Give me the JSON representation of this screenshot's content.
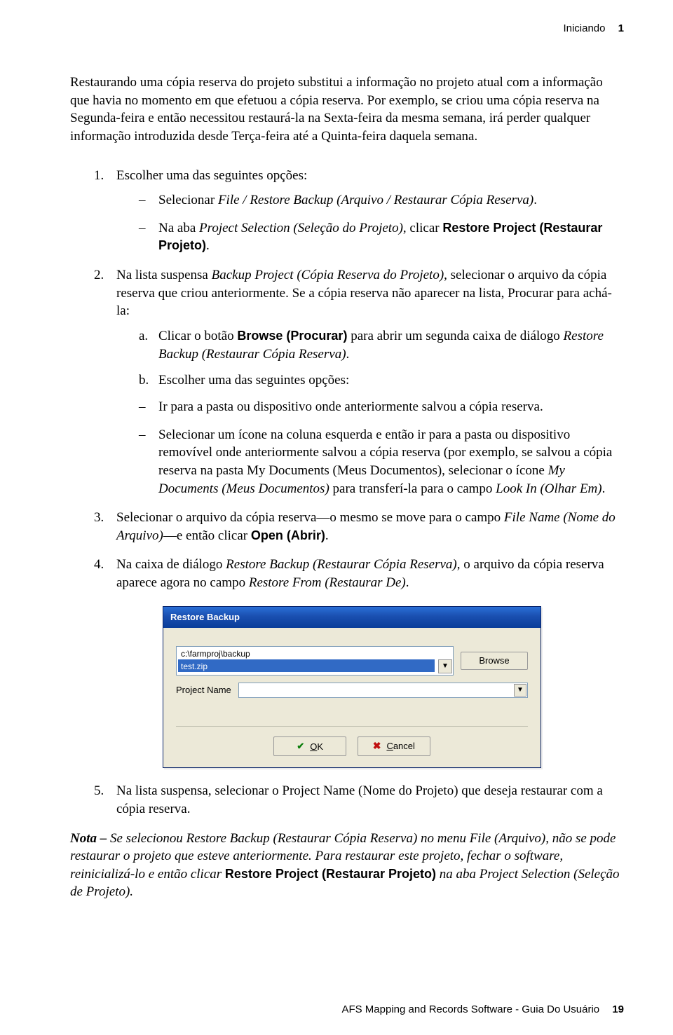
{
  "header": {
    "section": "Iniciando",
    "chapter": "1"
  },
  "intro": "Restaurando uma cópia reserva do projeto substitui a informação no projeto atual com a informação que havia no momento em que efetuou a cópia reserva. Por exemplo, se criou uma cópia reserva na Segunda-feira e então necessitou restaurá-la na Sexta-feira da mesma semana, irá perder qualquer informação introduzida desde Terça-feira até a Quinta-feira daquela semana.",
  "steps": {
    "s1": {
      "mk": "1.",
      "text": "Escolher uma das seguintes opções:",
      "b1a": "Selecionar ",
      "b1b": "File / Restore Backup (Arquivo / Restaurar Cópia Reserva)",
      "b1c": ".",
      "b2a": "Na aba ",
      "b2b": "Project Selection (Seleção do Projeto)",
      "b2c": ", clicar ",
      "b2d": "Restore Project (Restaurar Projeto)",
      "b2e": "."
    },
    "s2": {
      "mk": "2.",
      "t1": "Na lista suspensa ",
      "t2": "Backup Project (Cópia Reserva do Projeto)",
      "t3": ", selecionar o arquivo da cópia reserva que criou anteriormente. Se a cópia reserva não aparecer na lista, Procurar para achá-la:",
      "a_mk": "a.",
      "a1": "Clicar o botão ",
      "a2": "Browse (Procurar)",
      "a3": " para abrir um segunda caixa de diálogo ",
      "a4": "Restore Backup (Restaurar Cópia Reserva)",
      "a5": ".",
      "b_mk": "b.",
      "b1": "Escolher uma das seguintes opções:",
      "d1": "Ir para a pasta ou dispositivo onde anteriormente salvou a cópia reserva.",
      "d2a": "Selecionar um ícone na coluna esquerda e então ir para a pasta ou dispositivo removível onde anteriormente salvou a cópia reserva (por exemplo, se salvou a cópia reserva na pasta My Documents (Meus Documentos), selecionar o ícone ",
      "d2b": "My Documents (Meus Documentos)",
      "d2c": " para transferí-la para o campo ",
      "d2d": "Look In (Olhar Em)",
      "d2e": "."
    },
    "s3": {
      "mk": "3.",
      "t1": "Selecionar o arquivo da cópia reserva—o mesmo se move para o campo ",
      "t2": "File Name (Nome do Arquivo)",
      "t3": "—e então clicar ",
      "t4": "Open (Abrir)",
      "t5": "."
    },
    "s4": {
      "mk": "4.",
      "t1": "Na caixa de diálogo ",
      "t2": "Restore Backup (Restaurar Cópia Reserva)",
      "t3": ", o arquivo da cópia reserva aparece agora no campo ",
      "t4": "Restore From (Restaurar De)",
      "t5": "."
    },
    "s5": {
      "mk": "5.",
      "text": "Na lista suspensa, selecionar o Project Name (Nome do Projeto) que deseja restaurar com a cópia reserva."
    }
  },
  "dialog": {
    "title": "Restore Backup",
    "path": "c:\\farmproj\\backup",
    "selected": "test.zip",
    "dropdown_glyph": "▼",
    "browse": "Browse",
    "project_label": "Project Name",
    "ok_pre": "O",
    "ok_post": "K",
    "cancel_pre": "C",
    "cancel_post": "ancel"
  },
  "note": {
    "lead": "Nota – ",
    "t1": "Se selecionou Restore Backup (Restaurar Cópia Reserva) no menu File (Arquivo), não se pode restaurar o projeto que esteve anteriormente. Para restaurar este projeto, fechar o software, reinicializá-lo e então clicar ",
    "rp": "Restore Project (Restaurar Projeto)",
    "t2": " na aba Project Selection (Seleção de Projeto)."
  },
  "footer": {
    "title": "AFS Mapping and Records Software - Guia Do Usuário",
    "page": "19"
  }
}
